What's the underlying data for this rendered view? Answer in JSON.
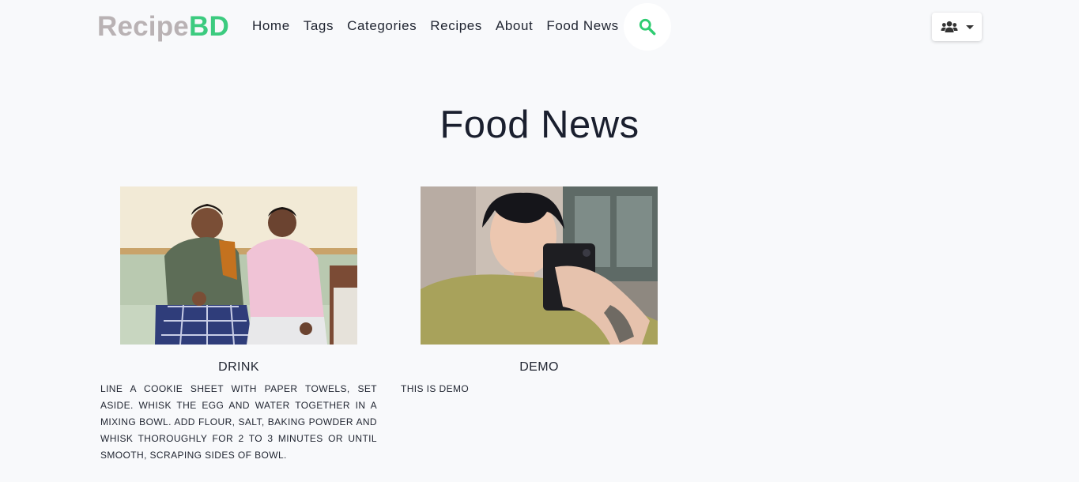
{
  "brand": {
    "part1": "Recipe",
    "part2": "BD"
  },
  "nav": {
    "items": [
      {
        "label": "Home"
      },
      {
        "label": "Tags"
      },
      {
        "label": "Categories"
      },
      {
        "label": "Recipes"
      },
      {
        "label": "About"
      },
      {
        "label": "Food News"
      }
    ],
    "search_icon": "search-icon",
    "user_menu_icon": "users-icon"
  },
  "colors": {
    "brand_gray": "#b9b2b4",
    "brand_green": "#3ccb7f",
    "search_icon": "#2ecc71"
  },
  "page": {
    "title": "Food News"
  },
  "news": [
    {
      "title": "DRINK",
      "text": "LINE A COOKIE SHEET WITH PAPER TOWELS, SET ASIDE. WHISK THE EGG AND WATER TOGETHER IN A MIXING BOWL. ADD FLOUR, SALT, BAKING POWDER AND WHISK THOROUGHLY FOR 2 TO 3 MINUTES OR UNTIL SMOOTH, SCRAPING SIDES OF BOWL."
    },
    {
      "title": "DEMO",
      "text": "THIS IS DEMO"
    }
  ]
}
